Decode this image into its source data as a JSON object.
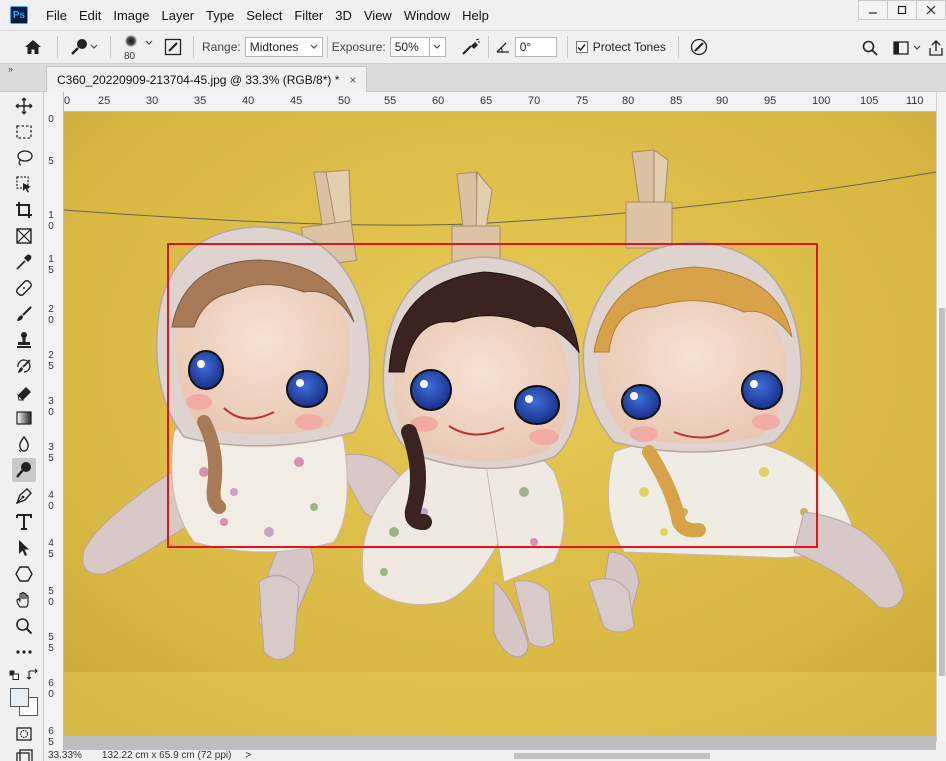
{
  "app": {
    "logo_text": "Ps",
    "menu": [
      "File",
      "Edit",
      "Image",
      "Layer",
      "Type",
      "Select",
      "Filter",
      "3D",
      "View",
      "Window",
      "Help"
    ],
    "window_buttons": [
      "minimize",
      "restore",
      "close"
    ]
  },
  "options": {
    "brush_size": "80",
    "range_label": "Range:",
    "range_value": "Midtones",
    "exposure_label": "Exposure:",
    "exposure_value": "50%",
    "angle_value": "0°",
    "protect_tones_label": "Protect Tones",
    "protect_tones_checked": true
  },
  "document": {
    "tab_title": "C360_20220909-213704-45.jpg @ 33.3% (RGB/8*) *",
    "close_glyph": "×"
  },
  "rulers": {
    "top_ticks": [
      "0",
      "25",
      "30",
      "35",
      "40",
      "45",
      "50",
      "55",
      "60",
      "65",
      "70",
      "75",
      "80",
      "85",
      "90",
      "95",
      "100",
      "105",
      "110"
    ],
    "left_ticks": [
      "0",
      "5",
      "10",
      "15",
      "20",
      "25",
      "30",
      "35",
      "40",
      "45",
      "50",
      "55",
      "60",
      "65"
    ]
  },
  "status": {
    "zoom": "33.33%",
    "doc_size": "132.22 cm x 65.9 cm (72 ppi)",
    "arrow": ">"
  },
  "colors": {
    "canvas_bg": "#dfc04a",
    "selection": "#e1151b",
    "foreground": "#e6f0f4",
    "background": "#ffffff"
  },
  "tools": [
    "move-icon",
    "marquee-icon",
    "lasso-icon",
    "object-select-icon",
    "crop-icon",
    "frame-icon",
    "eyedropper-icon",
    "healing-icon",
    "brush-icon",
    "stamp-icon",
    "history-brush-icon",
    "eraser-icon",
    "gradient-icon",
    "blur-icon",
    "dodge-burn-icon",
    "pen-icon",
    "type-icon",
    "path-select-icon",
    "shape-icon",
    "hand-icon",
    "zoom-icon",
    "more-icon"
  ]
}
